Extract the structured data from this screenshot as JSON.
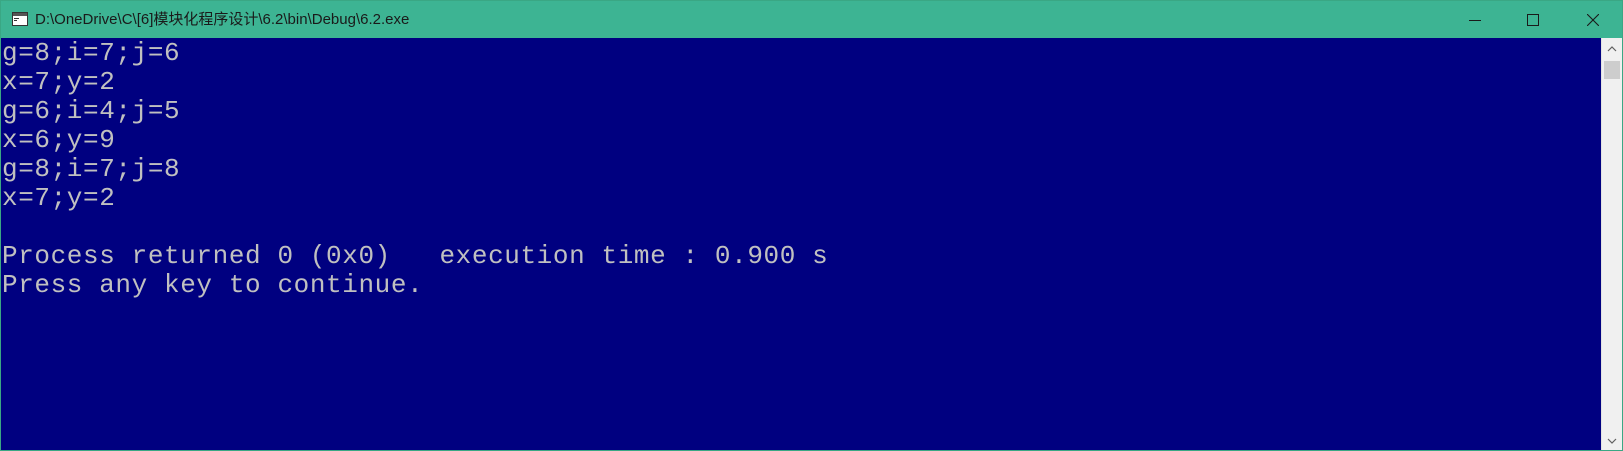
{
  "window": {
    "title": "D:\\OneDrive\\C\\[6]模块化程序设计\\6.2\\bin\\Debug\\6.2.exe",
    "icon": "console-window-icon",
    "controls": {
      "minimize": "minimize-icon",
      "maximize": "maximize-icon",
      "close": "close-icon"
    }
  },
  "console": {
    "lines": [
      "g=8;i=7;j=6",
      "x=7;y=2",
      "g=6;i=4;j=5",
      "x=6;y=9",
      "g=8;i=7;j=8",
      "x=7;y=2",
      "",
      "Process returned 0 (0x0)   execution time : 0.900 s",
      "Press any key to continue."
    ]
  },
  "colors": {
    "titlebar": "#3db493",
    "console_bg": "#000080",
    "console_text": "#c0c0c0"
  }
}
